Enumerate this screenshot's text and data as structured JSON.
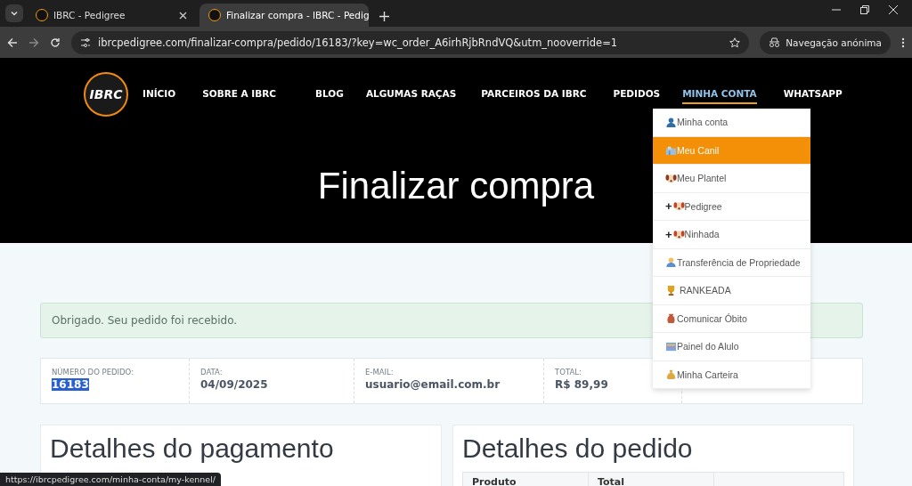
{
  "browser": {
    "tabs": [
      {
        "title": "IBRC - Pedigree",
        "selected": false
      },
      {
        "title": "Finalizar compra - IBRC - Pedig",
        "selected": true
      }
    ],
    "url": "ibrcpedigree.com/finalizar-compra/pedido/16183/?key=wc_order_A6irhRjbRndVQ&utm_nooverride=1",
    "incognito_label": "Navegação anónima"
  },
  "site": {
    "logo": "IBRC",
    "nav": [
      {
        "label": "INÍCIO",
        "selected": false
      },
      {
        "label": "SOBRE A IBRC",
        "selected": false
      },
      {
        "label": "BLOG",
        "selected": false
      },
      {
        "label": "ALGUMAS RAÇAS",
        "selected": false
      },
      {
        "label": "PARCEIROS DA IBRC",
        "selected": false
      },
      {
        "label": "PEDIDOS",
        "selected": false
      },
      {
        "label": "MINHA CONTA",
        "selected": true
      },
      {
        "label": "WHATSAPP",
        "selected": false
      }
    ],
    "dropdown": [
      {
        "kind": "user",
        "label": "Minha conta",
        "selected": false
      },
      {
        "kind": "kennel",
        "label": "Meu Canil",
        "selected": true
      },
      {
        "kind": "dog",
        "label": "Meu Plantel",
        "selected": false
      },
      {
        "kind": "add-dog",
        "prefix": "+",
        "label": "Pedigree",
        "selected": false
      },
      {
        "kind": "add-dog",
        "prefix": "+",
        "label": "Ninhada",
        "selected": false
      },
      {
        "kind": "person",
        "label": "Transferência de Propriedade",
        "selected": false
      },
      {
        "kind": "trophy",
        "label": " RANKEADA",
        "selected": false
      },
      {
        "kind": "urn",
        "label": "Comunicar Óbito",
        "selected": false
      },
      {
        "kind": "panel",
        "label": "Painel do Alulo",
        "selected": false
      },
      {
        "kind": "bag",
        "label": "Minha Carteira",
        "selected": false
      }
    ],
    "page_title": "Finalizar compra",
    "notice": "Obrigado. Seu pedido foi recebido.",
    "overview": [
      {
        "label": "NÚMERO DO PEDIDO:",
        "value": "16183",
        "highlighted": true
      },
      {
        "label": "DATA:",
        "value": "04/09/2025",
        "highlighted": false
      },
      {
        "label": "E-MAIL:",
        "value": "usuario@email.com.br",
        "highlighted": false
      },
      {
        "label": "TOTAL:",
        "value": "R$ 89,99",
        "highlighted": false
      }
    ],
    "payment_title": "Detalhes do pagamento",
    "order_title": "Detalhes do pedido",
    "order_table_columns": [
      "Produto",
      "Total"
    ]
  },
  "status_url": "https://ibrcpedigree.com/minha-conta/my-kennel/"
}
